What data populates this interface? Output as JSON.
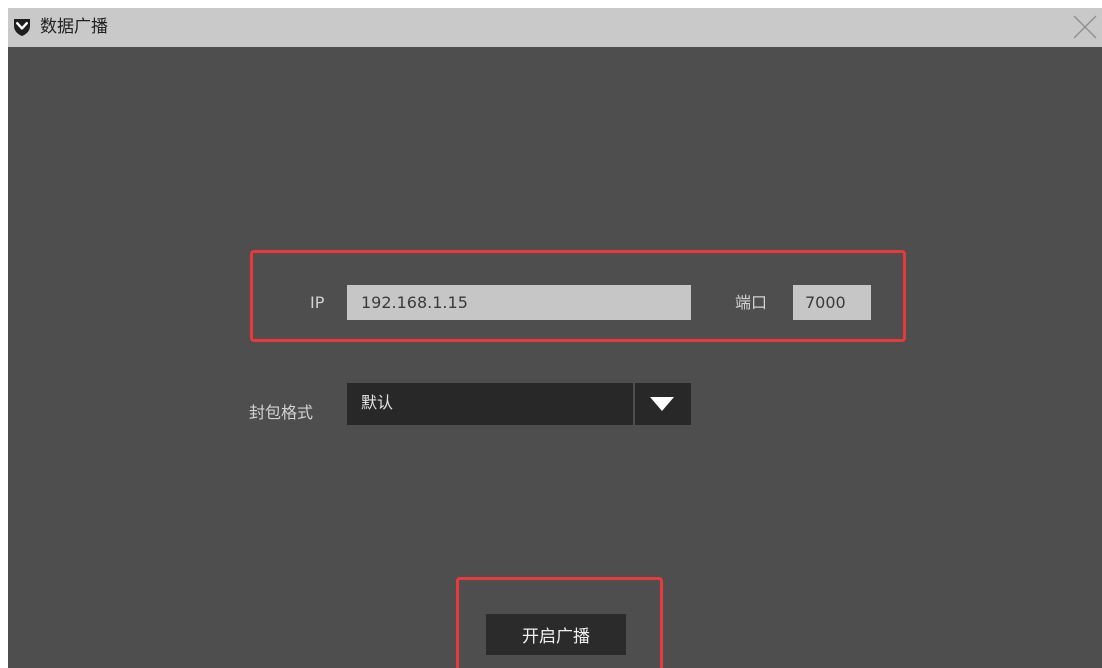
{
  "window": {
    "title": "数据广播",
    "icons": {
      "app": "shield-chevron-icon",
      "close": "close-icon"
    }
  },
  "form": {
    "ip_label": "IP",
    "ip_value": "192.168.1.15",
    "port_label": "端口",
    "port_value": "7000",
    "format_label": "封包格式",
    "format_selected": "默认",
    "format_dropdown_icon": "triangle-down-icon"
  },
  "actions": {
    "start_label": "开启广播"
  },
  "colors": {
    "highlight": "#e8393b",
    "titlebar": "#c9c9c9",
    "panel": "#4e4e4e"
  }
}
